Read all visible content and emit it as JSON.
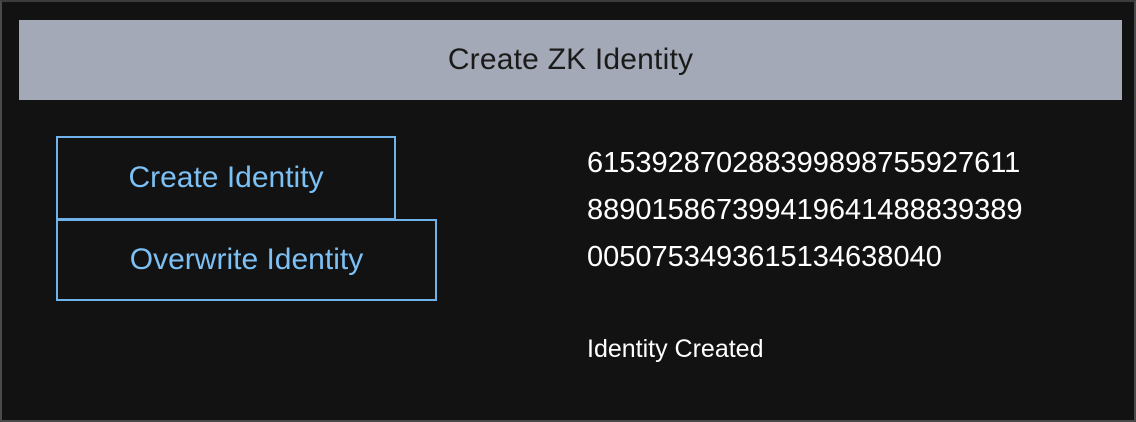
{
  "header": {
    "title": "Create ZK Identity"
  },
  "actions": {
    "create_label": "Create Identity",
    "overwrite_label": "Overwrite Identity"
  },
  "identity": {
    "lines": [
      "6153928702883998987559276​11",
      "889015867399419641488839389",
      "005075349361513463804 0"
    ]
  },
  "status": {
    "text": "Identity Created"
  },
  "colors": {
    "background": "#121213",
    "header_bg": "#a3a9b6",
    "button_border": "#6fb3ea",
    "button_text": "#7cc0f4",
    "text": "#ffffff"
  }
}
